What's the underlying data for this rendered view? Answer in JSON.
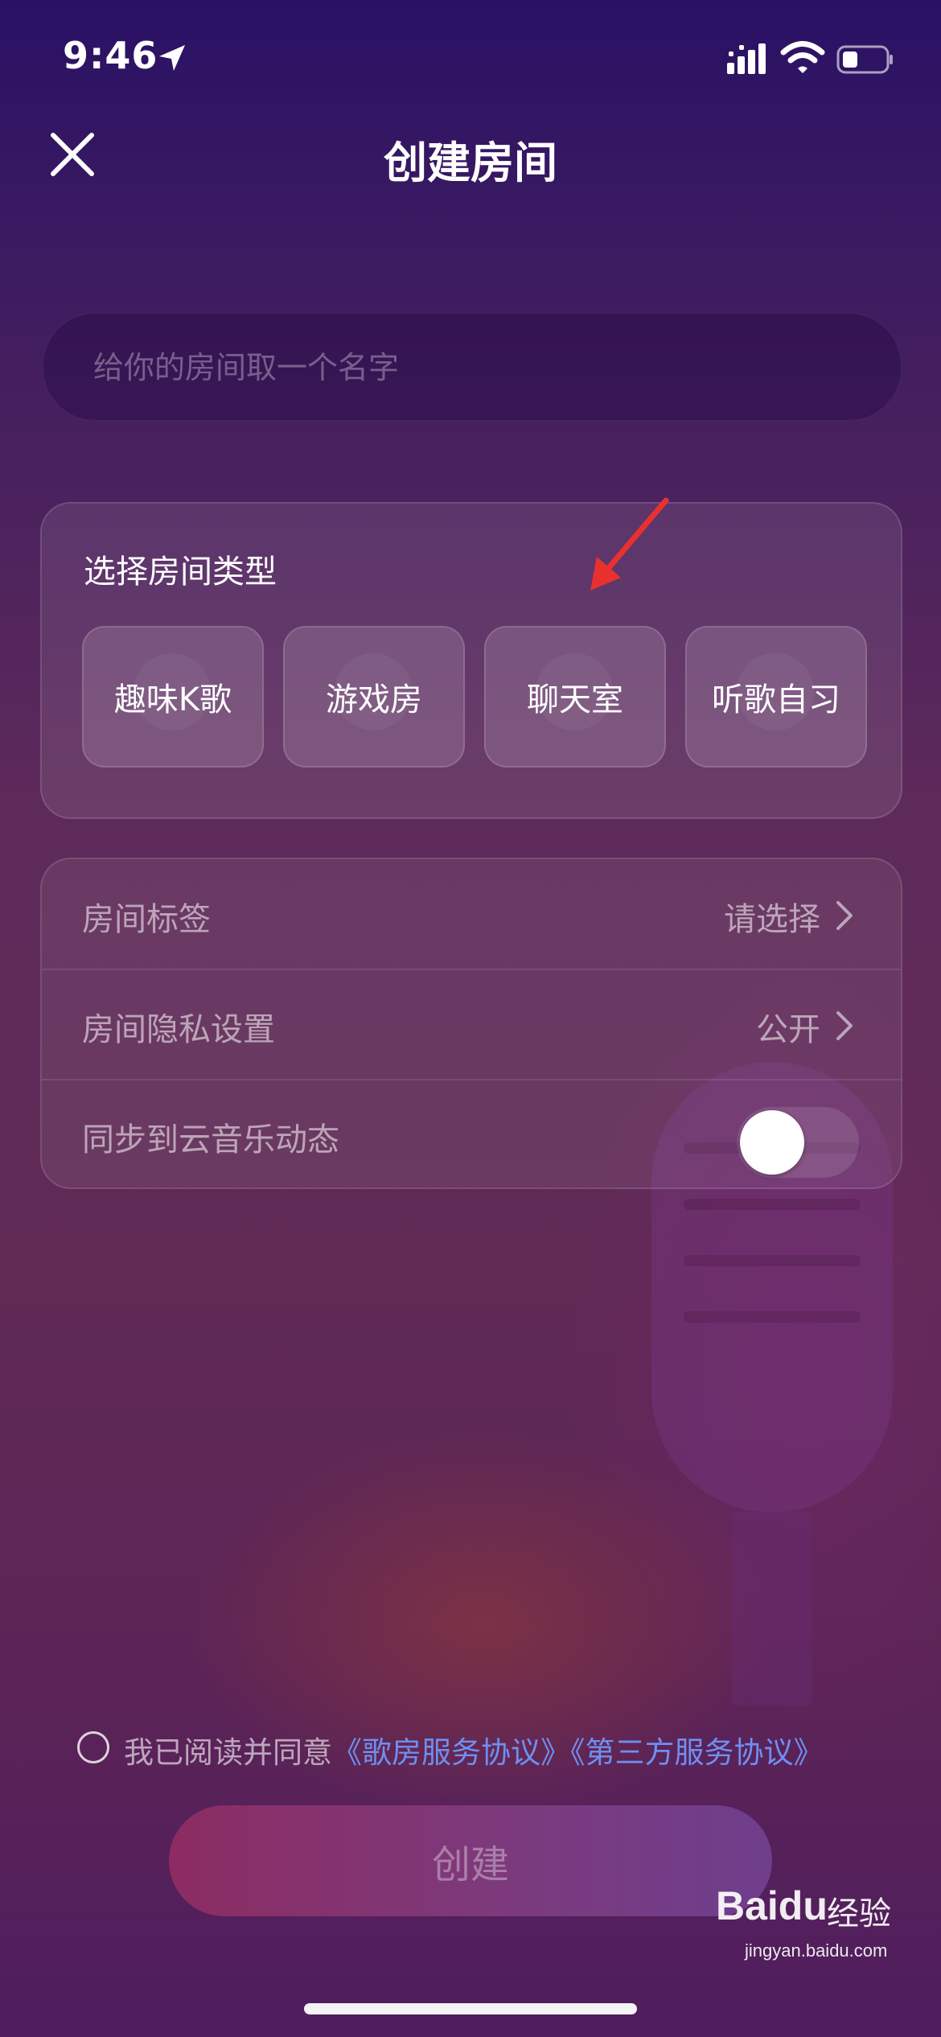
{
  "status_bar": {
    "time": "9:46",
    "icons": [
      "location-arrow-icon",
      "signal-icon",
      "wifi-icon",
      "battery-icon"
    ]
  },
  "header": {
    "title": "创建房间",
    "close_icon": "close-icon"
  },
  "room_name": {
    "placeholder": "给你的房间取一个名字",
    "value": ""
  },
  "room_type": {
    "title": "选择房间类型",
    "options": [
      {
        "label": "趣味K歌"
      },
      {
        "label": "游戏房"
      },
      {
        "label": "聊天室"
      },
      {
        "label": "听歌自习"
      }
    ],
    "annotation_color": "#e8312f"
  },
  "settings": {
    "tags": {
      "label": "房间标签",
      "value": "请选择"
    },
    "privacy": {
      "label": "房间隐私设置",
      "value": "公开"
    },
    "sync": {
      "label": "同步到云音乐动态",
      "enabled": false
    }
  },
  "agreement": {
    "prefix": "我已阅读并同意",
    "link1": "《歌房服务协议》",
    "link2": "《第三方服务协议》",
    "checked": false,
    "link_color": "#6f8ff2"
  },
  "create_button": {
    "label": "创建"
  },
  "watermark": {
    "brand": "Baidu",
    "cn": "经验",
    "url": "jingyan.baidu.com"
  }
}
